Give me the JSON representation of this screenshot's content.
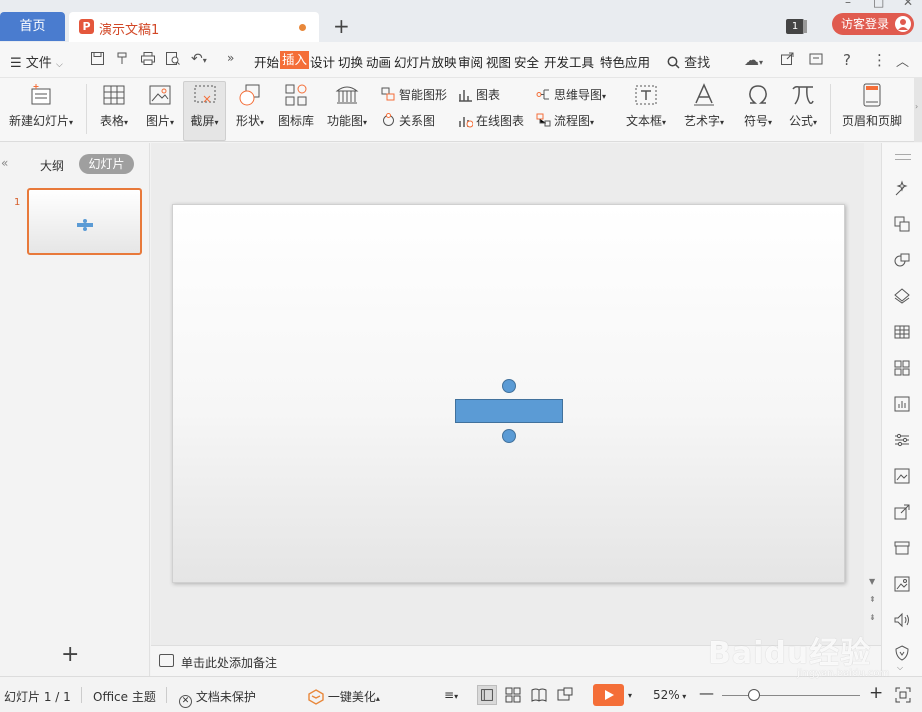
{
  "titlebar": {
    "home_tab": "首页",
    "doc_tab": "演示文稿1",
    "doc_icon_letter": "P",
    "window_count": "1",
    "visitor_login": "访客登录"
  },
  "menubar": {
    "file": "文件",
    "tabs": [
      "开始",
      "插入",
      "设计",
      "切换",
      "动画",
      "幻灯片放映",
      "审阅",
      "视图",
      "安全",
      "开发工具",
      "特色应用"
    ],
    "active_tab": "插入",
    "search": "查找"
  },
  "ribbon": {
    "new_slide": "新建幻灯片",
    "table": "表格",
    "picture": "图片",
    "screenshot": "截屏",
    "shape": "形状",
    "icon_library": "图标库",
    "function_chart": "功能图",
    "smart_shape": "智能图形",
    "chart": "图表",
    "relation_chart": "关系图",
    "online_chart": "在线图表",
    "mind_map": "思维导图",
    "flowchart": "流程图",
    "textbox": "文本框",
    "word_art": "艺术字",
    "symbol": "符号",
    "formula": "公式",
    "header_footer": "页眉和页脚"
  },
  "leftpanel": {
    "outline_tab": "大纲",
    "slides_tab": "幻灯片",
    "slide_number": "1"
  },
  "notes": {
    "placeholder": "单击此处添加备注"
  },
  "statusbar": {
    "slide_counter": "幻灯片 1 / 1",
    "theme": "Office 主题",
    "protection": "文档未保护",
    "beautify": "一键美化",
    "zoom": "52%"
  },
  "watermark": {
    "brand": "Baidu经验",
    "url": "jingyan.baidu.com"
  },
  "colors": {
    "accent_orange": "#f46e38",
    "home_tab_blue": "#4a7ccf",
    "shape_blue": "#5b9bd5",
    "visitor_red": "#e05b4f"
  }
}
